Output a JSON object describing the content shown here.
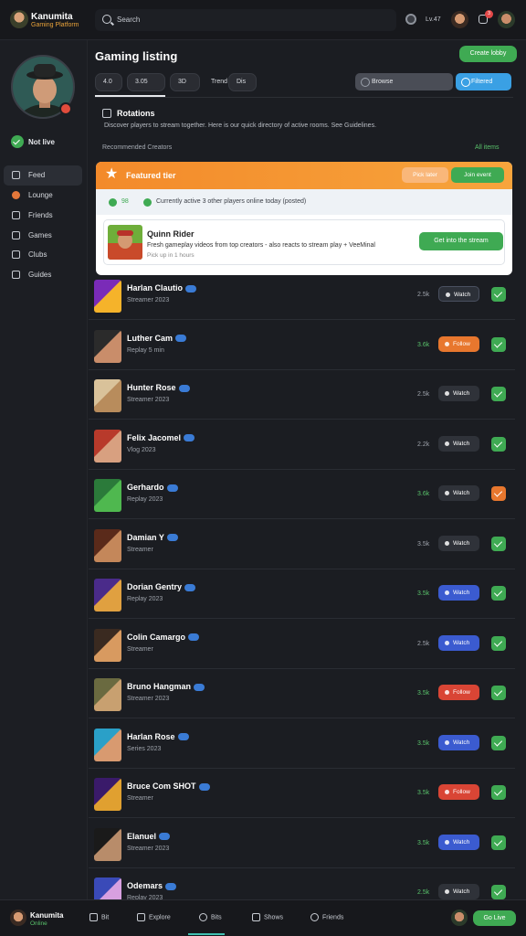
{
  "app": {
    "name": "Kanumita",
    "subtitle": "Gaming Platform"
  },
  "topbar": {
    "search_placeholder": "Search",
    "status_label": "Lv.47",
    "notif_count": "3"
  },
  "sidebar": {
    "online_label": "Not live",
    "items": [
      {
        "label": "Feed",
        "icon": "home-icon"
      },
      {
        "label": "Lounge",
        "icon": "lounge-icon"
      },
      {
        "label": "Friends",
        "icon": "friends-icon"
      },
      {
        "label": "Games",
        "icon": "games-icon"
      },
      {
        "label": "Clubs",
        "icon": "clubs-icon"
      },
      {
        "label": "Guides",
        "icon": "guides-icon"
      }
    ]
  },
  "header": {
    "title": "Gaming listing",
    "new_button": "Create lobby",
    "chips": [
      "4.0",
      "3.05",
      "3D",
      "Trend",
      "Dis"
    ],
    "select_value": "Browse",
    "filter_button": "Filtered"
  },
  "section": {
    "title": "Rotations",
    "description": "Discover players to stream together. Here is our quick directory of active rooms. See Guidelines.",
    "list_label": "Recommended Creators",
    "list_link": "All items"
  },
  "featured": {
    "banner_title": "Featured tier",
    "btn_secondary": "Pick later",
    "btn_primary": "Join event",
    "status_a": "98",
    "status_text": "Currently active 3 other players online today (posted)",
    "card_name": "Quinn Rider",
    "card_desc": "Fresh gameplay videos from top creators - also reacts to stream play + VeeMinal",
    "card_sub": "Pick up in 1 hours",
    "card_button": "Get into the stream"
  },
  "rows": [
    {
      "name": "Harlan Clautio",
      "sub": "Streamer 2023",
      "num": "2.5k",
      "btn": "Watch",
      "btn_color": "#2c3038",
      "check_color": "#3faa53",
      "green": false,
      "av": [
        "#7a2bb8",
        "#f5b32a"
      ]
    },
    {
      "name": "Luther Cam",
      "sub": "Replay 5 min",
      "num": "3.6k",
      "btn": "Follow",
      "btn_color": "#e8772e",
      "check_color": "#3faa53",
      "green": true,
      "av": [
        "#2b2b2b",
        "#c98d6a"
      ]
    },
    {
      "name": "Hunter Rose",
      "sub": "Streamer 2023",
      "num": "2.5k",
      "btn": "Watch",
      "btn_color": "#2f3239",
      "check_color": "#3faa53",
      "green": false,
      "av": [
        "#d9c29a",
        "#b88c5c"
      ]
    },
    {
      "name": "Felix Jacomel",
      "sub": "Vlog 2023",
      "num": "2.2k",
      "btn": "Watch",
      "btn_color": "#2f3239",
      "check_color": "#3faa53",
      "green": false,
      "av": [
        "#b83a2b",
        "#d8a080"
      ]
    },
    {
      "name": "Gerhardo",
      "sub": "Replay 2023",
      "num": "3.6k",
      "btn": "Watch",
      "btn_color": "#2f3239",
      "check_color": "#e8772e",
      "green": true,
      "av": [
        "#2b7a3a",
        "#4fb84f"
      ]
    },
    {
      "name": "Damian Y",
      "sub": "Streamer",
      "num": "3.5k",
      "btn": "Watch",
      "btn_color": "#2f3239",
      "check_color": "#3faa53",
      "green": false,
      "av": [
        "#5a2a1a",
        "#c4875a"
      ]
    },
    {
      "name": "Dorian Gentry",
      "sub": "Replay 2023",
      "num": "3.5k",
      "btn": "Watch",
      "btn_color": "#3b5bd0",
      "check_color": "#3faa53",
      "green": true,
      "av": [
        "#4a2b8a",
        "#e0a040"
      ]
    },
    {
      "name": "Colin Camargo",
      "sub": "Streamer",
      "num": "2.5k",
      "btn": "Watch",
      "btn_color": "#3b5bd0",
      "check_color": "#3faa53",
      "green": false,
      "av": [
        "#3a2a20",
        "#d89a60"
      ]
    },
    {
      "name": "Bruno Hangman",
      "sub": "Streamer 2023",
      "num": "3.5k",
      "btn": "Follow",
      "btn_color": "#d94535",
      "check_color": "#3faa53",
      "green": true,
      "av": [
        "#6a6a40",
        "#c8a070"
      ]
    },
    {
      "name": "Harlan Rose",
      "sub": "Series 2023",
      "num": "3.5k",
      "btn": "Watch",
      "btn_color": "#3b5bd0",
      "check_color": "#3faa53",
      "green": true,
      "av": [
        "#2aa0c8",
        "#d89a70"
      ]
    },
    {
      "name": "Bruce Com SHOT",
      "sub": "Streamer",
      "num": "3.5k",
      "btn": "Follow",
      "btn_color": "#d94535",
      "check_color": "#3faa53",
      "green": true,
      "av": [
        "#3a1a6a",
        "#e0a030"
      ]
    },
    {
      "name": "Elanuel",
      "sub": "Streamer 2023",
      "num": "3.5k",
      "btn": "Watch",
      "btn_color": "#3b5bd0",
      "check_color": "#3faa53",
      "green": true,
      "av": [
        "#1a1a1a",
        "#b88c6a"
      ]
    },
    {
      "name": "Odemars",
      "sub": "Replay 2023",
      "num": "2.5k",
      "btn": "Watch",
      "btn_color": "#2f3239",
      "check_color": "#3faa53",
      "green": true,
      "av": [
        "#3a4ab8",
        "#d8a0e0"
      ]
    }
  ],
  "bottom": {
    "user_name": "Kanumita",
    "user_status": "Online",
    "nav": [
      "Bit",
      "Explore",
      "Bits",
      "Shows",
      "Friends"
    ],
    "action_button": "Go Live"
  }
}
